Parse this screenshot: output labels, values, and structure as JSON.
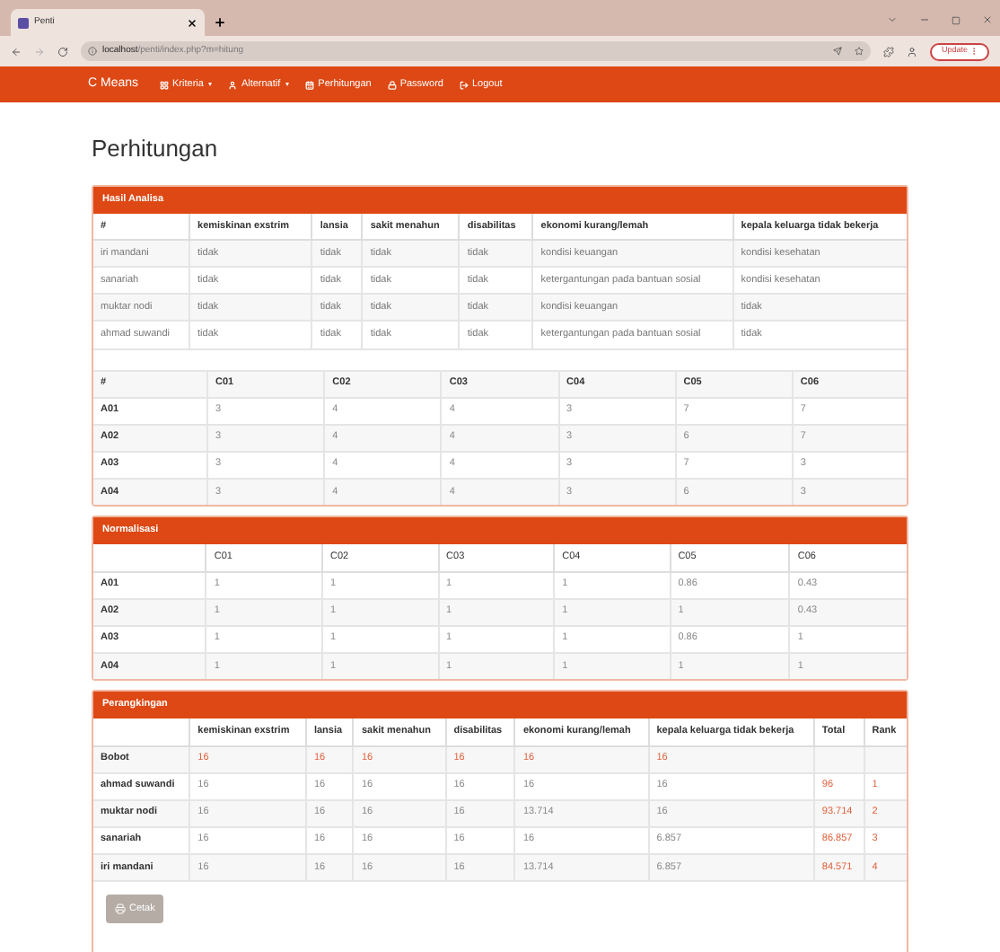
{
  "browser": {
    "tab_title": "Penti",
    "url_host": "localhost",
    "url_path": "/penti/index.php?m=hitung",
    "update_label": "Update"
  },
  "navbar": {
    "brand": "C Means",
    "items": [
      {
        "label": "Kriteria",
        "dropdown": true
      },
      {
        "label": "Alternatif",
        "dropdown": true
      },
      {
        "label": "Perhitungan",
        "dropdown": false
      },
      {
        "label": "Password",
        "dropdown": false
      },
      {
        "label": "Logout",
        "dropdown": false
      }
    ]
  },
  "page_title": "Perhitungan",
  "analysis": {
    "title": "Hasil Analisa",
    "columns": [
      "#",
      "kemiskinan exstrim",
      "lansia",
      "sakit menahun",
      "disabilitas",
      "ekonomi kurang/lemah",
      "kepala keluarga tidak bekerja"
    ],
    "rows": [
      [
        "iri mandani",
        "tidak",
        "tidak",
        "tidak",
        "tidak",
        "kondisi keuangan",
        "kondisi kesehatan"
      ],
      [
        "sanariah",
        "tidak",
        "tidak",
        "tidak",
        "tidak",
        "ketergantungan pada bantuan sosial",
        "kondisi kesehatan"
      ],
      [
        "muktar nodi",
        "tidak",
        "tidak",
        "tidak",
        "tidak",
        "kondisi keuangan",
        "tidak"
      ],
      [
        "ahmad suwandi",
        "tidak",
        "tidak",
        "tidak",
        "tidak",
        "ketergantungan pada bantuan sosial",
        "tidak"
      ]
    ],
    "matrix_columns": [
      "#",
      "C01",
      "C02",
      "C03",
      "C04",
      "C05",
      "C06"
    ],
    "matrix_rows": [
      [
        "A01",
        "3",
        "4",
        "4",
        "3",
        "7",
        "7"
      ],
      [
        "A02",
        "3",
        "4",
        "4",
        "3",
        "6",
        "7"
      ],
      [
        "A03",
        "3",
        "4",
        "4",
        "3",
        "7",
        "3"
      ],
      [
        "A04",
        "3",
        "4",
        "4",
        "3",
        "6",
        "3"
      ]
    ]
  },
  "normalization": {
    "title": "Normalisasi",
    "columns": [
      "",
      "C01",
      "C02",
      "C03",
      "C04",
      "C05",
      "C06"
    ],
    "rows": [
      [
        "A01",
        "1",
        "1",
        "1",
        "1",
        "0.86",
        "0.43"
      ],
      [
        "A02",
        "1",
        "1",
        "1",
        "1",
        "1",
        "0.43"
      ],
      [
        "A03",
        "1",
        "1",
        "1",
        "1",
        "0.86",
        "1"
      ],
      [
        "A04",
        "1",
        "1",
        "1",
        "1",
        "1",
        "1"
      ]
    ]
  },
  "ranking": {
    "title": "Perangkingan",
    "columns": [
      "",
      "kemiskinan exstrim",
      "lansia",
      "sakit menahun",
      "disabilitas",
      "ekonomi kurang/lemah",
      "kepala keluarga tidak bekerja",
      "Total",
      "Rank"
    ],
    "rows": [
      {
        "kind": "weight",
        "cells": [
          "Bobot",
          "16",
          "16",
          "16",
          "16",
          "16",
          "16"
        ]
      },
      {
        "kind": "alternative",
        "cells": [
          "ahmad suwandi",
          "16",
          "16",
          "16",
          "16",
          "16",
          "16",
          "96",
          "1"
        ]
      },
      {
        "kind": "alternative",
        "cells": [
          "muktar nodi",
          "16",
          "16",
          "16",
          "16",
          "13.714",
          "16",
          "93.714",
          "2"
        ]
      },
      {
        "kind": "alternative",
        "cells": [
          "sanariah",
          "16",
          "16",
          "16",
          "16",
          "16",
          "6.857",
          "86.857",
          "3"
        ]
      },
      {
        "kind": "alternative",
        "cells": [
          "iri mandani",
          "16",
          "16",
          "16",
          "16",
          "13.714",
          "6.857",
          "84.571",
          "4"
        ]
      }
    ],
    "print_button": "Cetak"
  }
}
